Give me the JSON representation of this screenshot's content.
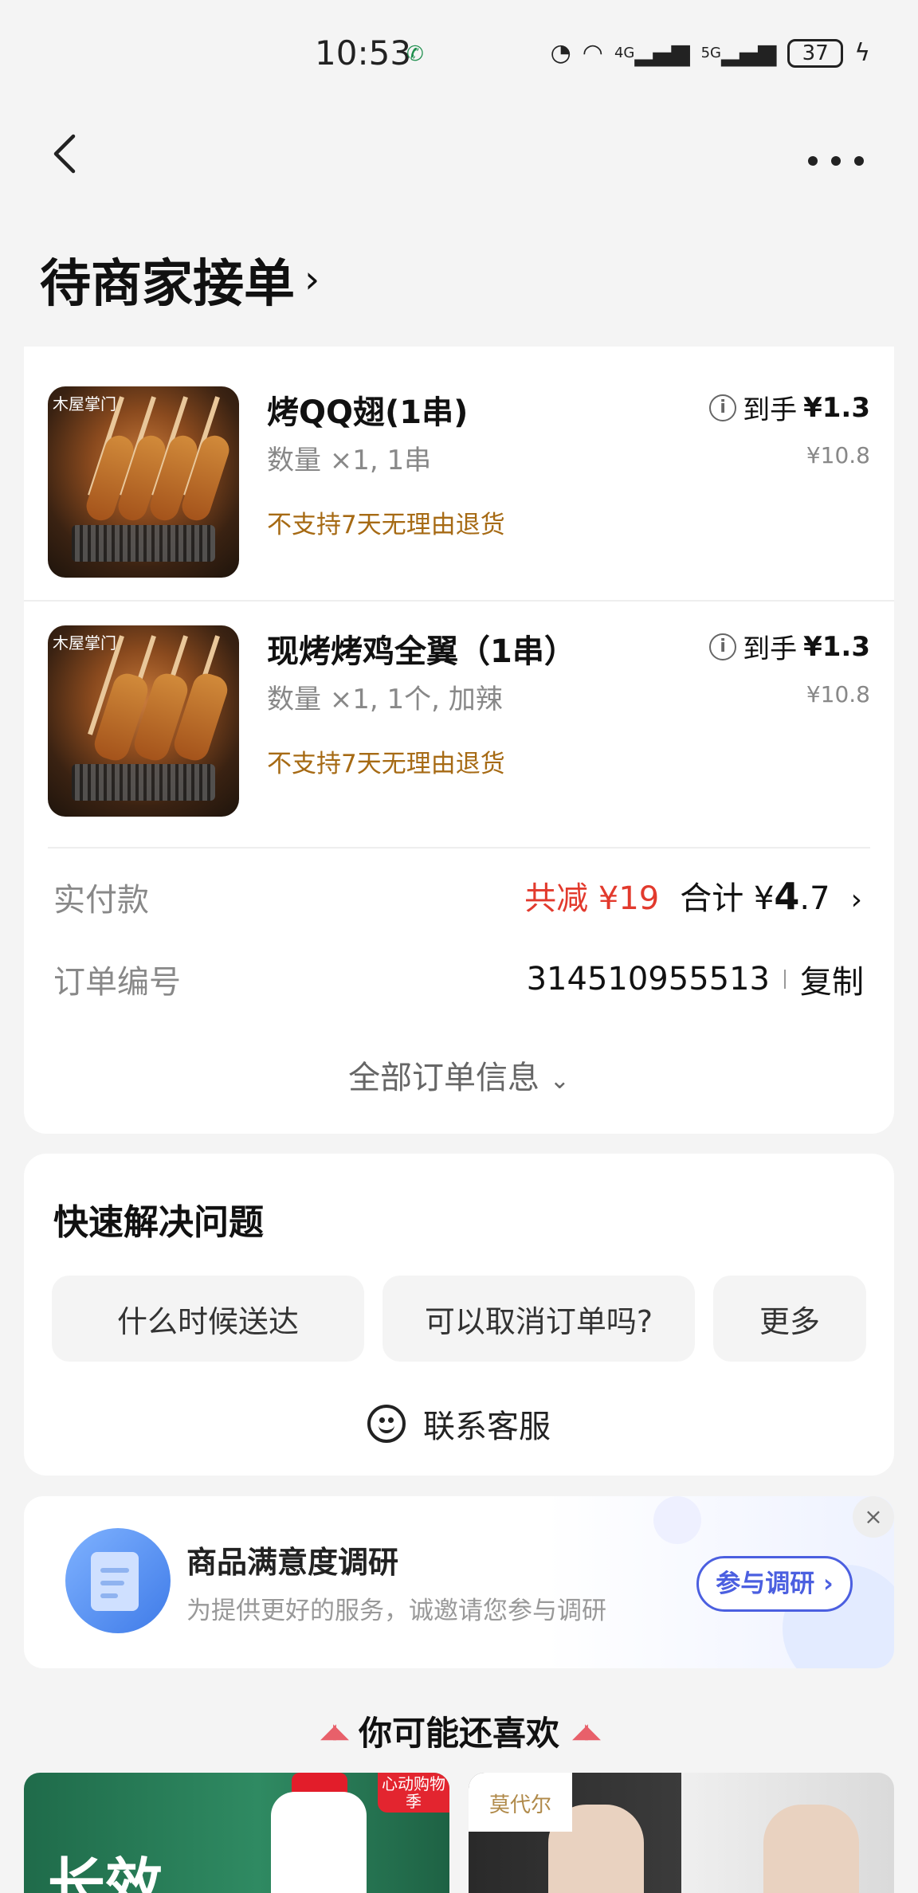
{
  "status_bar": {
    "time": "10:53",
    "carrier_icon": "telecom-icon",
    "icons": [
      "speed-icon",
      "wifi-icon",
      "4g-signal-icon",
      "5g-signal-icon"
    ],
    "network_4g": "4G",
    "network_5g": "5G",
    "battery": "37"
  },
  "nav": {
    "back_icon": "back-arrow-icon",
    "more_icon": "more-dots-icon"
  },
  "order_status": {
    "title": "待商家接单",
    "chevron": "›"
  },
  "products": [
    {
      "thumb_brand": "木屋掌门",
      "name": "烤QQ翅(1串)",
      "spec": "数量 ×1, 1串",
      "policy": "不支持7天无理由退货",
      "net_label": "到手",
      "net_price": "¥1.3",
      "original_price": "¥10.8"
    },
    {
      "thumb_brand": "木屋掌门",
      "name": "现烤烤鸡全翼（1串）",
      "spec": "数量 ×1, 1个, 加辣",
      "policy": "不支持7天无理由退货",
      "net_label": "到手",
      "net_price": "¥1.3",
      "original_price": "¥10.8"
    }
  ],
  "payment": {
    "label": "实付款",
    "saving": "共减 ¥19",
    "total_label": "合计",
    "total_currency": "¥",
    "total_int": "4",
    "total_dec": ".7",
    "chevron": "›"
  },
  "order_no": {
    "label": "订单编号",
    "value": "314510955513",
    "copy": "复制"
  },
  "all_info": {
    "label": "全部订单信息",
    "chevron": "⌄"
  },
  "quick": {
    "title": "快速解决问题",
    "buttons": [
      "什么时候送达",
      "可以取消订单吗?",
      "更多"
    ],
    "customer_service": "联系客服"
  },
  "survey": {
    "title": "商品满意度调研",
    "subtitle": "为提供更好的服务，诚邀请您参与调研",
    "button": "参与调研 ›",
    "close": "×"
  },
  "recommend": {
    "title": "你可能还喜欢",
    "left_text": "长效",
    "left_tag": "心动购物季",
    "right_brand": "莫代尔"
  },
  "colors": {
    "accent_red": "#e23a2d",
    "policy_brown": "#a66a14",
    "survey_blue": "#4b5fe0",
    "background": "#f4f4f4"
  }
}
